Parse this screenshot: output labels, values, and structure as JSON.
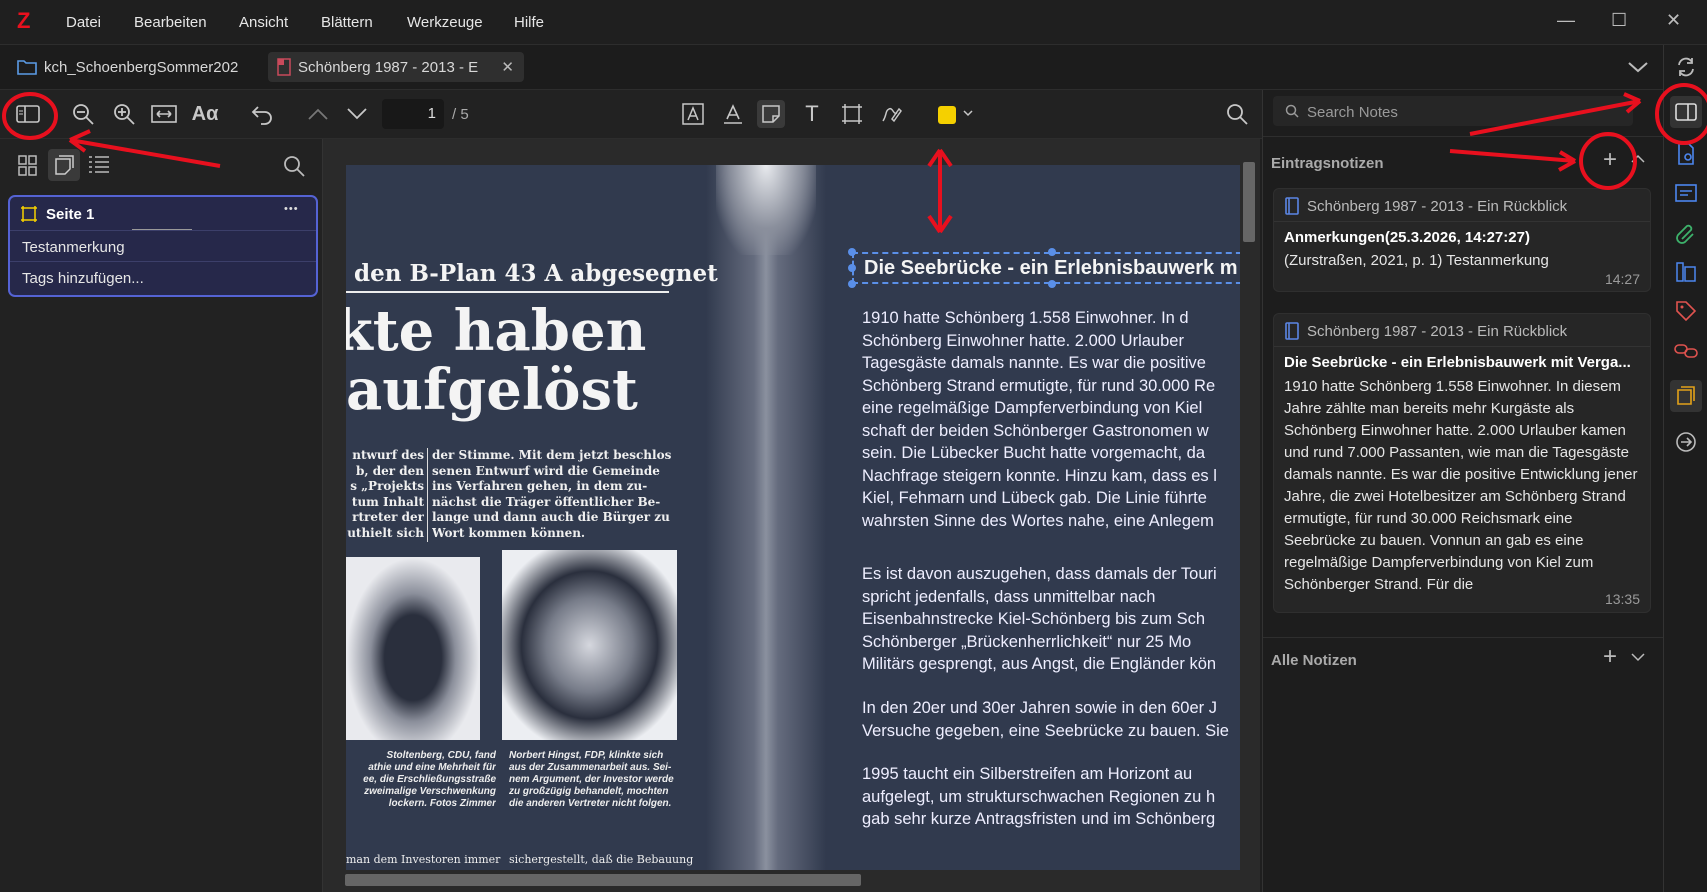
{
  "app": {
    "logo": "Z",
    "menu": [
      "Datei",
      "Bearbeiten",
      "Ansicht",
      "Blättern",
      "Werkzeuge",
      "Hilfe"
    ]
  },
  "window_controls": {
    "minimize": "—",
    "maximize": "☐",
    "close": "✕"
  },
  "tabs": [
    {
      "label": "kch_SchoenbergSommer202"
    },
    {
      "label": "Schönberg 1987 - 2013 - E"
    }
  ],
  "toolbar": {
    "page_current": "1",
    "page_total": "/ 5",
    "highlight_color": "#f5d000"
  },
  "sidebar": {
    "annotation": {
      "title": "Seite 1",
      "more": "•••",
      "comment": "Testanmerkung",
      "tags_placeholder": "Tags hinzufügen..."
    }
  },
  "pdf": {
    "left_headline": "den B-Plan 43 A abgesegnet",
    "big_line1": "kte haben",
    "big_line2": "aufgelöst",
    "col1": [
      "ntwurf des",
      "b, der den",
      "s „Projekts",
      "tum Inhalt",
      "rtreter der",
      "uthielt sich"
    ],
    "col2": [
      "der Stimme. Mit dem jetzt beschlos-",
      "senen Entwurf wird die Gemeinde",
      "ins Verfahren gehen, in dem zu-",
      "nächst die Träger öffentlicher Be-",
      "lange und dann auch die Bürger zu",
      "Wort kommen können."
    ],
    "cap_left": [
      "Stoltenberg, CDU, fand",
      "athie und eine Mehrheit für",
      "ee, die Erschließungsstraße",
      "zweimalige Verschwenkung",
      "lockern.            Fotos Zimmer"
    ],
    "cap_right": [
      "Norbert Hingst, FDP, klinkte sich",
      "aus der Zusammenarbeit aus. Sei-",
      "nem Argument, der Investor werde",
      "zu großzügig behandelt, mochten",
      "die anderen Vertreter nicht folgen."
    ],
    "bottom_left": "man dem Investoren immer",
    "bottom_right": "sichergestellt, daß die Bebauung",
    "right_title": "Die Seebrücke - ein Erlebnisbauwerk m",
    "right_p1": [
      "1910 hatte Schönberg 1.558 Einwohner. In d",
      "Schönberg Einwohner hatte. 2.000 Urlauber",
      "Tagesgäste damals nannte. Es war die positive",
      "Schönberg Strand ermutigte, für rund 30.000 Re",
      "eine regelmäßige Dampferverbindung von Kiel",
      "schaft der beiden Schönberger Gastronomen w",
      "sein. Die Lübecker Bucht hatte vorgemacht, da",
      "Nachfrage steigern konnte. Hinzu kam, dass es l",
      "Kiel, Fehmarn und Lübeck gab. Die Linie führte",
      "wahrsten Sinne des Wortes nahe, eine Anlegem"
    ],
    "right_p2": [
      "Es ist davon auszugehen, dass damals der Touri",
      "spricht jedenfalls, dass unmittelbar nach",
      "Eisenbahnstrecke Kiel-Schönberg bis zum Sch",
      "Schönberger „Brückenherrlichkeit“ nur 25 Mo",
      "Militärs gesprengt, aus Angst, die Engländer kön"
    ],
    "right_p3": [
      "In den 20er und 30er Jahren sowie in den 60er J",
      "Versuche gegeben, eine Seebrücke zu bauen. Sie"
    ],
    "right_p4": [
      "1995 taucht ein Silberstreifen am Horizont au",
      "aufgelegt, um strukturschwachen Regionen zu h",
      "gab sehr kurze Antragsfristen und im Schönberg"
    ]
  },
  "notes": {
    "search_placeholder": "Search Notes",
    "section1": "Eintragsnotizen",
    "section2": "Alle Notizen",
    "items": [
      {
        "parent": "Schönberg 1987 - 2013 - Ein Rückblick",
        "title": "Anmerkungen(25.3.2026, 14:27:27)",
        "body": "(Zurstraßen, 2021, p. 1) Testanmerkung",
        "time": "14:27"
      },
      {
        "parent": "Schönberg 1987 - 2013 - Ein Rückblick",
        "title": "Die Seebrücke - ein Erlebnisbauwerk mit Verga...",
        "body": "1910 hatte Schönberg 1.558 Einwohner. In diesem Jahre zählte man bereits mehr Kurgäste als Schönberg Einwohner hatte. 2.000 Urlauber kamen und rund 7.000 Passanten, wie man die Tagesgäste damals nannte. Es war die positive Entwicklung jener Jahre, die zwei Hotelbesitzer am Schönberg Strand ermutigte, für rund 30.000 Reichsmark eine Seebrücke zu bauen. Vonnun an gab es eine regelmäßige Dampferverbindung von Kiel zum Schönberger Strand. Für die",
        "time": "13:35"
      }
    ]
  }
}
